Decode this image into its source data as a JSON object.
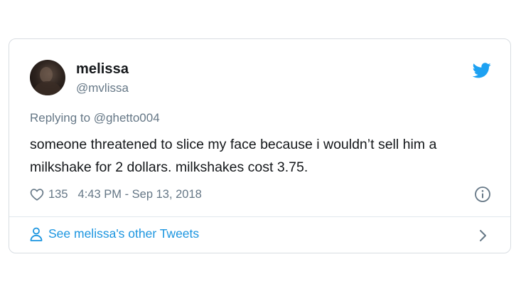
{
  "author": {
    "display_name": "melissa",
    "handle": "@mvlissa"
  },
  "reply": {
    "prefix": "Replying to ",
    "mention": "@ghetto004"
  },
  "tweet": {
    "text": "someone threatened to slice my face because i wouldn’t sell him a milkshake for 2 dollars. milkshakes cost 3.75.",
    "likes": "135",
    "timestamp": "4:43 PM - Sep 13, 2018"
  },
  "footer": {
    "link_label": "See melissa's other Tweets"
  },
  "icons": {
    "brand": "twitter-bird-icon",
    "like": "heart-icon",
    "info": "info-icon",
    "profile": "person-icon",
    "next": "chevron-right-icon"
  },
  "colors": {
    "brand_blue": "#1da1f2",
    "link_blue": "#1b95e0",
    "text_primary": "#14171a",
    "text_secondary": "#657786",
    "border": "#d8dde2"
  }
}
